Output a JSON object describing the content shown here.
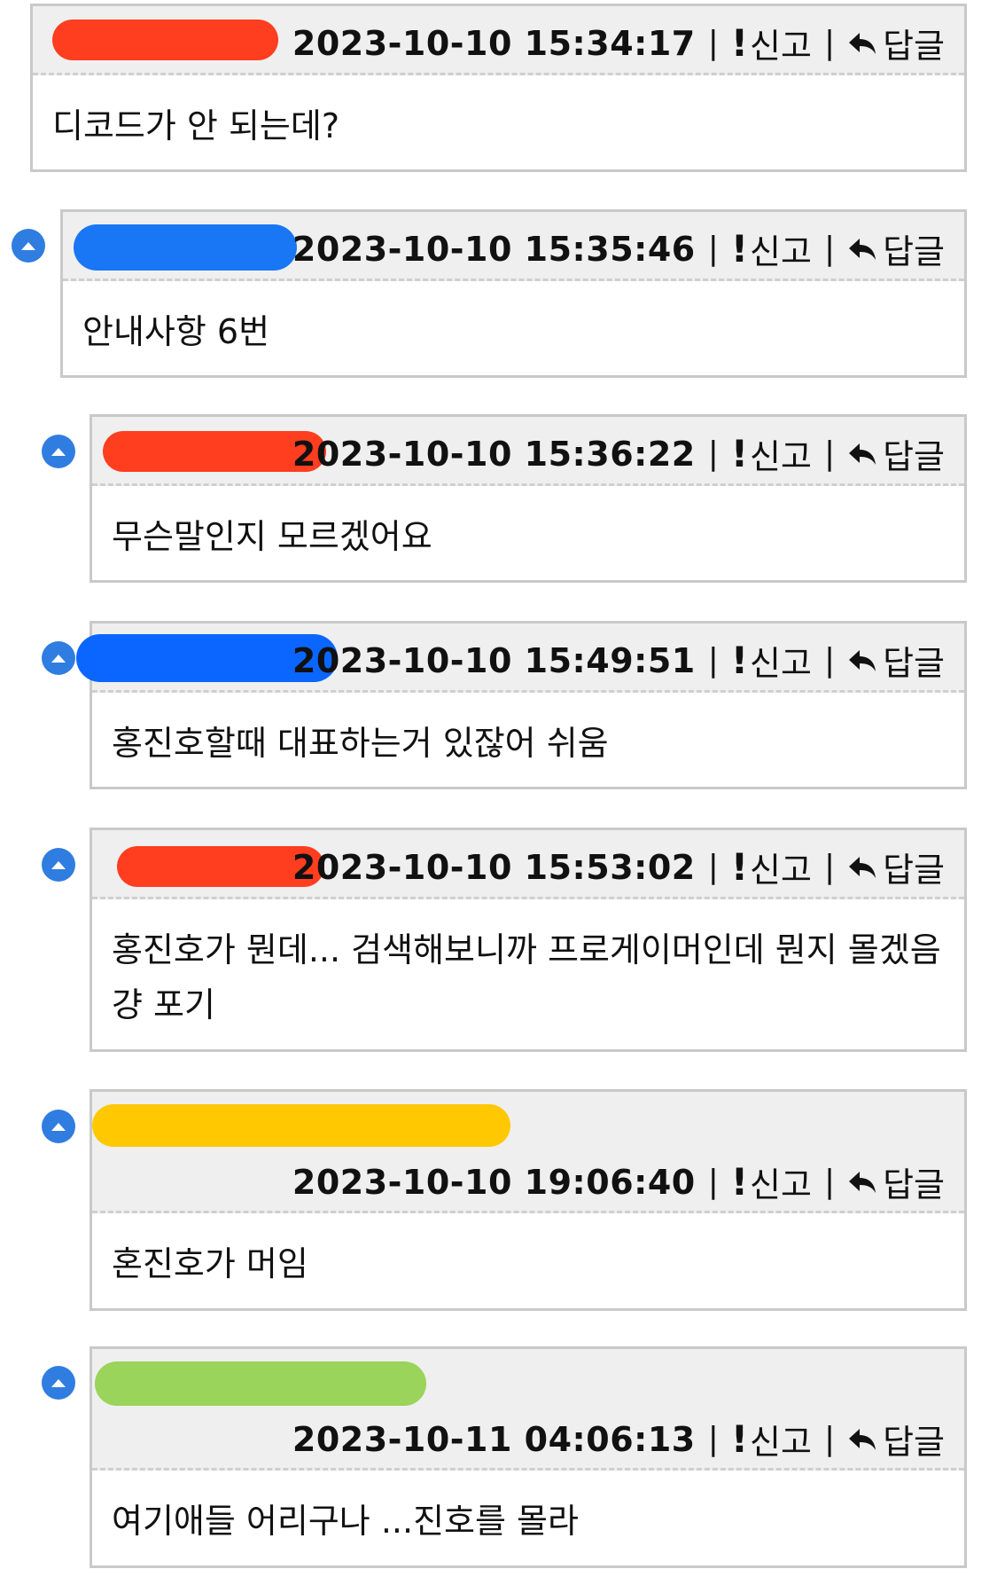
{
  "colors": {
    "header_bg": "#efefef",
    "border": "#c9c9c9",
    "up_button": "#2f7de1",
    "redactions": [
      "#ff3d1f",
      "#1976f5",
      "#ff3d1f",
      "#0a66ff",
      "#ff3d1f",
      "#ffc800",
      "#9ad45a"
    ]
  },
  "icons": {
    "report": "exclamation-icon",
    "reply": "reply-arrow-icon",
    "upvote": "chevron-up-circle-icon"
  },
  "labels": {
    "report": "신고",
    "reply": "답글",
    "divider": "|"
  },
  "comments": [
    {
      "timestamp": "2023-10-10 15:34:17",
      "text": "디코드가 안 되는데?"
    },
    {
      "timestamp": "2023-10-10 15:35:46",
      "text": "안내사항 6번"
    },
    {
      "timestamp": "2023-10-10 15:36:22",
      "text": "무슨말인지 모르겠어요"
    },
    {
      "timestamp": "2023-10-10 15:49:51",
      "text": "홍진호할때 대표하는거 있잖어 쉬움"
    },
    {
      "timestamp": "2023-10-10 15:53:02",
      "text": "홍진호가 뭔데... 검색해보니까 프로게이머인데 뭔지 몰겠음",
      "text2": "걍 포기"
    },
    {
      "timestamp": "2023-10-10 19:06:40",
      "text": "혼진호가 머임"
    },
    {
      "timestamp": "2023-10-11 04:06:13",
      "text": "여기애들 어리구나 ...진호를 몰라"
    }
  ]
}
